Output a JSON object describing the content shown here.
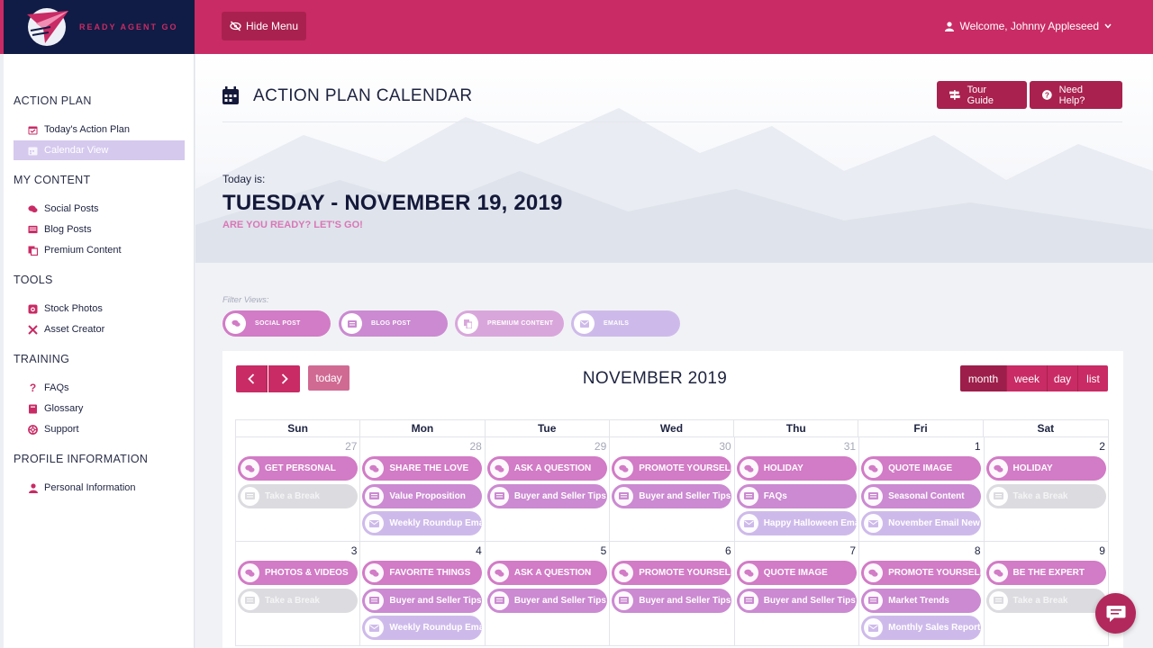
{
  "brand": {
    "name": "READY AGENT GO"
  },
  "topbar": {
    "hide_menu_label": "Hide Menu",
    "welcome_label": "Welcome, Johnny Appleseed"
  },
  "sidebar": {
    "sections": [
      {
        "title": "ACTION PLAN",
        "items": [
          {
            "label": "Today's Action Plan"
          },
          {
            "label": "Calendar View"
          }
        ]
      },
      {
        "title": "MY CONTENT",
        "items": [
          {
            "label": "Social Posts"
          },
          {
            "label": "Blog Posts"
          },
          {
            "label": "Premium Content"
          }
        ]
      },
      {
        "title": "TOOLS",
        "items": [
          {
            "label": "Stock Photos"
          },
          {
            "label": "Asset Creator"
          }
        ]
      },
      {
        "title": "TRAINING",
        "items": [
          {
            "label": "FAQs"
          },
          {
            "label": "Glossary"
          },
          {
            "label": "Support"
          }
        ]
      },
      {
        "title": "PROFILE INFORMATION",
        "items": [
          {
            "label": "Personal Information"
          }
        ]
      }
    ],
    "active_item": "Calendar View"
  },
  "header": {
    "title": "ACTION PLAN CALENDAR",
    "tour_guide_label": "Tour Guide",
    "need_help_label": "Need Help?",
    "today_label": "Today is:",
    "today_date": "TUESDAY - NOVEMBER 19, 2019",
    "tagline": "ARE YOU READY? LET'S GO!"
  },
  "filters": {
    "label": "Filter Views:",
    "items": [
      {
        "label": "SOCIAL POST",
        "color": "#d27bc6"
      },
      {
        "label": "BLOG POST",
        "color": "#cb8ad1"
      },
      {
        "label": "PREMIUM CONTENT",
        "color": "#d9a6db"
      },
      {
        "label": "EMAILS",
        "color": "#cebaea"
      }
    ]
  },
  "calendar": {
    "title": "NOVEMBER 2019",
    "today_label": "today",
    "views": [
      "month",
      "week",
      "day",
      "list"
    ],
    "active_view": "month",
    "weekdays": [
      "Sun",
      "Mon",
      "Tue",
      "Wed",
      "Thu",
      "Fri",
      "Sat"
    ],
    "weeks": [
      [
        {
          "num": "27",
          "other": true,
          "events": [
            {
              "t": "social",
              "label": "GET PERSONAL"
            },
            {
              "t": "break",
              "label": "Take a Break"
            }
          ]
        },
        {
          "num": "28",
          "other": true,
          "events": [
            {
              "t": "social",
              "label": "SHARE THE LOVE"
            },
            {
              "t": "blog",
              "label": "Value Proposition"
            },
            {
              "t": "email",
              "label": "Weekly Roundup Ema"
            }
          ]
        },
        {
          "num": "29",
          "other": true,
          "events": [
            {
              "t": "social",
              "label": "ASK A QUESTION"
            },
            {
              "t": "blog",
              "label": "Buyer and Seller Tips"
            }
          ]
        },
        {
          "num": "30",
          "other": true,
          "events": [
            {
              "t": "social",
              "label": "PROMOTE YOURSELF"
            },
            {
              "t": "blog",
              "label": "Buyer and Seller Tips"
            }
          ]
        },
        {
          "num": "31",
          "other": true,
          "events": [
            {
              "t": "social",
              "label": "HOLIDAY"
            },
            {
              "t": "blog",
              "label": "FAQs"
            },
            {
              "t": "email",
              "label": "Happy Halloween Ema"
            }
          ]
        },
        {
          "num": "1",
          "other": false,
          "events": [
            {
              "t": "social",
              "label": "QUOTE IMAGE"
            },
            {
              "t": "blog",
              "label": "Seasonal Content"
            },
            {
              "t": "email",
              "label": "November Email New"
            }
          ]
        },
        {
          "num": "2",
          "other": false,
          "events": [
            {
              "t": "social",
              "label": "HOLIDAY"
            },
            {
              "t": "break",
              "label": "Take a Break"
            }
          ]
        }
      ],
      [
        {
          "num": "3",
          "other": false,
          "events": [
            {
              "t": "social",
              "label": "PHOTOS & VIDEOS"
            },
            {
              "t": "break",
              "label": "Take a Break"
            }
          ]
        },
        {
          "num": "4",
          "other": false,
          "events": [
            {
              "t": "social",
              "label": "FAVORITE THINGS"
            },
            {
              "t": "blog",
              "label": "Buyer and Seller Tips"
            },
            {
              "t": "email",
              "label": "Weekly Roundup Ema"
            }
          ]
        },
        {
          "num": "5",
          "other": false,
          "events": [
            {
              "t": "social",
              "label": "ASK A QUESTION"
            },
            {
              "t": "blog",
              "label": "Buyer and Seller Tips"
            }
          ]
        },
        {
          "num": "6",
          "other": false,
          "events": [
            {
              "t": "social",
              "label": "PROMOTE YOURSELF"
            },
            {
              "t": "blog",
              "label": "Buyer and Seller Tips"
            }
          ]
        },
        {
          "num": "7",
          "other": false,
          "events": [
            {
              "t": "social",
              "label": "QUOTE IMAGE"
            },
            {
              "t": "blog",
              "label": "Buyer and Seller Tips"
            }
          ]
        },
        {
          "num": "8",
          "other": false,
          "events": [
            {
              "t": "social",
              "label": "PROMOTE YOURSELF"
            },
            {
              "t": "blog",
              "label": "Market Trends"
            },
            {
              "t": "email",
              "label": "Monthly Sales Report"
            }
          ]
        },
        {
          "num": "9",
          "other": false,
          "events": [
            {
              "t": "social",
              "label": "BE THE EXPERT"
            },
            {
              "t": "break",
              "label": "Take a Break"
            }
          ]
        }
      ]
    ]
  },
  "colors": {
    "primary": "#c92b64",
    "primary_dark": "#a9214f",
    "navy": "#101c45"
  }
}
